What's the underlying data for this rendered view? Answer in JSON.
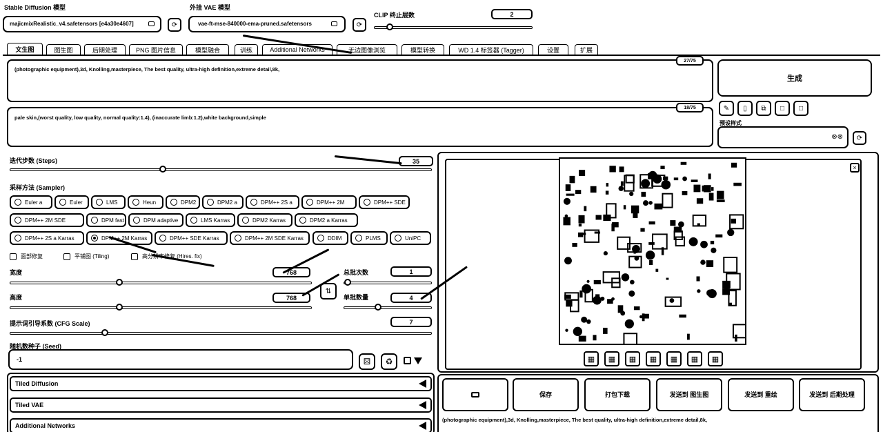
{
  "top": {
    "model_label": "Stable Diffusion 模型",
    "model_value": "majicmixRealistic_v4.safetensors [e4a30e4607]",
    "vae_label": "外挂 VAE 模型",
    "vae_value": "vae-ft-mse-840000-ema-pruned.safetensors",
    "clip_label": "CLIP 终止层数",
    "clip_value": "2",
    "clip_fraction": 0.08
  },
  "tabs": [
    "文生图",
    "图生图",
    "后期处理",
    "PNG 图片信息",
    "模型融合",
    "训练",
    "Additional Networks",
    "无边图像浏览",
    "模型转换",
    "WD 1.4 标签器 (Tagger)",
    "设置",
    "扩展"
  ],
  "active_tab": "文生图",
  "prompt": {
    "positive": "(photographic equipment),3d, Knolling,masterpiece, The best quality, ultra-high definition,extreme detail,8k,",
    "positive_count": "27/75",
    "negative": "pale skin,(worst quality, low quality, normal quality:1.4), (inaccurate limb:1.2),white background,simple",
    "negative_count": "18/75"
  },
  "generate_label": "生成",
  "style_label": "预设样式",
  "style_icons": [
    "pencil-icon",
    "trash-icon",
    "clipboard-icon",
    "square-icon",
    "save-icon"
  ],
  "steps": {
    "label": "迭代步数 (Steps)",
    "value": "35",
    "fraction": 0.36
  },
  "sampler": {
    "label": "采样方法 (Sampler)",
    "options": [
      "Euler a",
      "Euler",
      "LMS",
      "Heun",
      "DPM2",
      "DPM2 a",
      "DPM++ 2S a",
      "DPM++ 2M",
      "DPM++ SDE",
      "DPM++ 2M SDE",
      "DPM fast",
      "DPM adaptive",
      "LMS Karras",
      "DPM2 Karras",
      "DPM2 a Karras",
      "DPM++ 2S a Karras",
      "DPM++ 2M Karras",
      "DPM++ SDE Karras",
      "DPM++ 2M SDE Karras",
      "DDIM",
      "PLMS",
      "UniPC"
    ],
    "selected": "DPM++ 2M Karras"
  },
  "checkboxes": [
    "面部修复",
    "平铺图 (Tiling)",
    "高分辨率修复 (Hires. fix)"
  ],
  "width": {
    "label": "宽度",
    "value": "768",
    "fraction": 0.36
  },
  "height": {
    "label": "高度",
    "value": "768",
    "fraction": 0.36
  },
  "batch_count": {
    "label": "总批次数",
    "value": "1",
    "fraction": 0.0
  },
  "batch_size": {
    "label": "单批数量",
    "value": "4",
    "fraction": 0.38
  },
  "cfg": {
    "label": "提示词引导系数 (CFG Scale)",
    "value": "7",
    "fraction": 0.22
  },
  "seed": {
    "label": "随机数种子 (Seed)",
    "value": "-1"
  },
  "accordions": [
    "Tiled Diffusion",
    "Tiled VAE",
    "Additional Networks"
  ],
  "output_buttons": [
    "保存",
    "打包下载",
    "发送到 图生图",
    "发送到 重绘",
    "发送到 后期处理"
  ],
  "output_prompt": "(photographic equipment),3d, Knolling,masterpiece, The best quality, ultra-high definition,extreme detail,8k,"
}
